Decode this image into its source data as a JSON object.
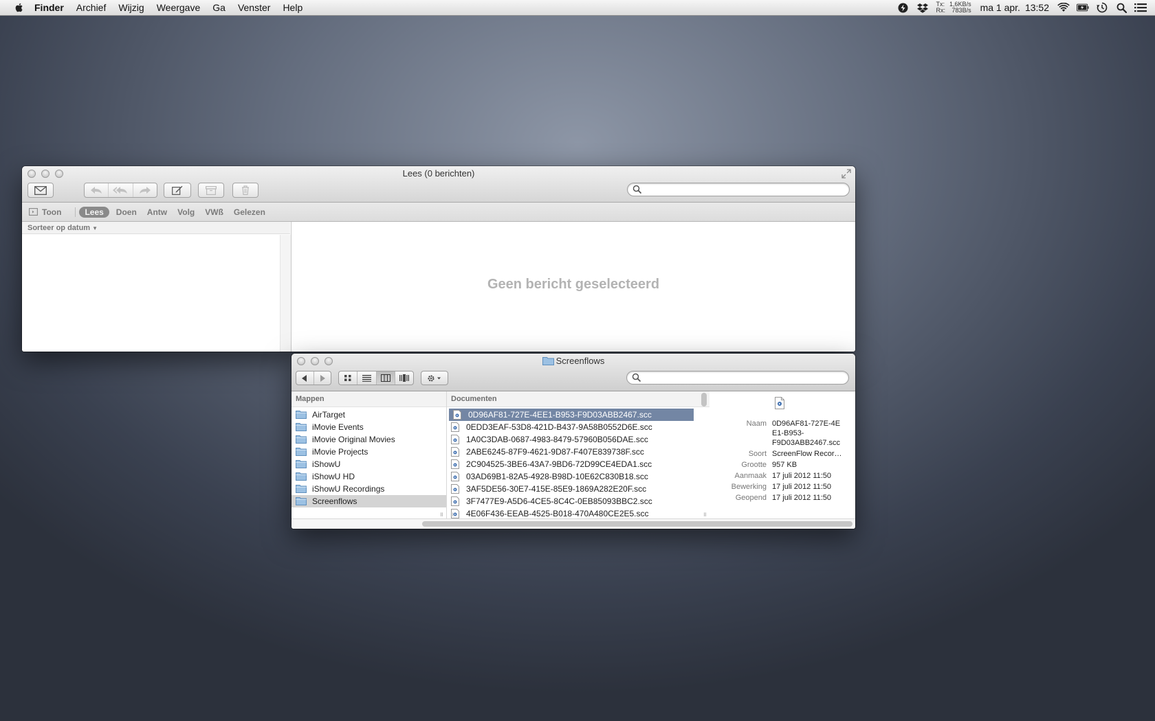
{
  "menubar": {
    "app": "Finder",
    "items": [
      "Archief",
      "Wijzig",
      "Weergave",
      "Ga",
      "Venster",
      "Help"
    ],
    "net_tx_label": "Tx:",
    "net_rx_label": "Rx:",
    "net_tx_value": "1,6KB/s",
    "net_rx_value": "783B/s",
    "date": "ma 1 apr.",
    "time": "13:52"
  },
  "mail": {
    "title": "Lees (0 berichten)",
    "favorites": {
      "show": "Toon",
      "items": [
        "Lees",
        "Doen",
        "Antw",
        "Volg",
        "VWß",
        "Gelezen"
      ],
      "active": "Lees"
    },
    "sort_label": "Sorteer op datum",
    "no_selection": "Geen bericht geselecteerd",
    "search_placeholder": ""
  },
  "finder": {
    "title": "Screenflows",
    "sidebar_header": "Mappen",
    "folders": [
      "AirTarget",
      "iMovie Events",
      "iMovie Original Movies",
      "iMovie Projects",
      "iShowU",
      "iShowU HD",
      "iShowU Recordings",
      "Screenflows"
    ],
    "selected_folder": "Screenflows",
    "files_header": "Documenten",
    "files": [
      "0D96AF81-727E-4EE1-B953-F9D03ABB2467.scc",
      "0EDD3EAF-53D8-421D-B437-9A58B0552D6E.scc",
      "1A0C3DAB-0687-4983-8479-57960B056DAE.scc",
      "2ABE6245-87F9-4621-9D87-F407E839738F.scc",
      "2C904525-3BE6-43A7-9BD6-72D99CE4EDA1.scc",
      "03AD69B1-82A5-4928-B98D-10E62C830B18.scc",
      "3AF5DE56-30E7-415E-85E9-1869A282E20F.scc",
      "3F7477E9-A5D6-4CE5-8C4C-0EB85093BBC2.scc",
      "4E06F436-EEAB-4525-B018-470A480CE2E5.scc"
    ],
    "selected_file": "0D96AF81-727E-4EE1-B953-F9D03ABB2467.scc",
    "info": {
      "name_label": "Naam",
      "name_lines": [
        "0D96AF81-727E-4E",
        "E1-B953-",
        "F9D03ABB2467.scc"
      ],
      "kind_label": "Soort",
      "kind": "ScreenFlow Recor…",
      "size_label": "Grootte",
      "size": "957 KB",
      "created_label": "Aanmaak",
      "created": "17 juli 2012 11:50",
      "modified_label": "Bewerking",
      "modified": "17 juli 2012 11:50",
      "opened_label": "Geopend",
      "opened": "17 juli 2012 11:50"
    }
  },
  "colors": {
    "selection_blue": "#7386a4",
    "selection_grey": "#d4d4d4",
    "folder_blue": "#8fb7dc"
  }
}
